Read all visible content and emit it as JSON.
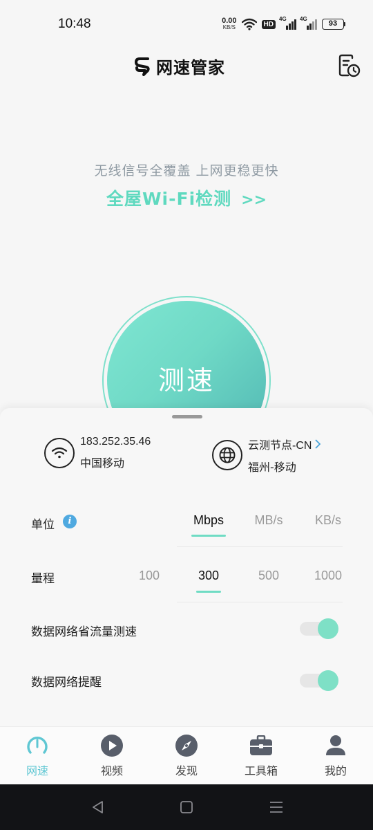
{
  "status_bar": {
    "time": "10:48",
    "net_speed_value": "0.00",
    "net_speed_unit": "KB/S",
    "hd_label": "HD",
    "signal_1_label": "4G",
    "signal_2_label": "4G",
    "battery": "93"
  },
  "header": {
    "app_title": "网速管家",
    "history_icon": "history-clock-icon"
  },
  "promo": {
    "subtitle": "无线信号全覆盖  上网更稳更快",
    "link_text": "全屋Wi-Fi检测",
    "link_arrow": ">>"
  },
  "speed_test": {
    "button_label": "测速"
  },
  "connection": {
    "ip": "183.252.35.46",
    "isp": "中国移动",
    "node_label": "云测节点-CN",
    "node_location": "福州-移动"
  },
  "settings": {
    "unit_label": "单位",
    "unit_info_icon": "i",
    "unit_options": [
      "Mbps",
      "MB/s",
      "KB/s"
    ],
    "unit_selected": "Mbps",
    "range_label": "量程",
    "range_options": [
      "100",
      "300",
      "500",
      "1000"
    ],
    "range_selected": "300",
    "data_saving_label": "数据网络省流量测速",
    "data_saving_on": true,
    "data_reminder_label": "数据网络提醒",
    "data_reminder_on": true
  },
  "bottom_nav": {
    "items": [
      {
        "label": "网速",
        "icon": "speedometer-icon",
        "active": true
      },
      {
        "label": "视频",
        "icon": "play-icon",
        "active": false
      },
      {
        "label": "发现",
        "icon": "compass-icon",
        "active": false
      },
      {
        "label": "工具箱",
        "icon": "toolbox-icon",
        "active": false
      },
      {
        "label": "我的",
        "icon": "user-icon",
        "active": false
      }
    ]
  },
  "colors": {
    "accent": "#6fdcc4",
    "link_blue": "#4aa4d9",
    "active_nav": "#5fc7d3"
  }
}
